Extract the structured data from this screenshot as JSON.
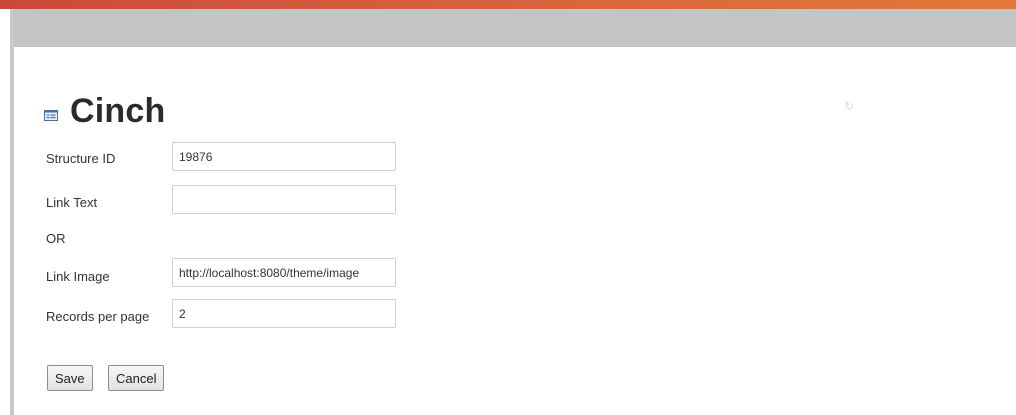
{
  "page": {
    "title": "Cinch",
    "title_icon": "form-icon",
    "accent_color": "#d7603e",
    "header_bar_color": "#c4c4c4"
  },
  "form": {
    "structure_id": {
      "label": "Structure ID",
      "value": "19876"
    },
    "link_text": {
      "label": "Link Text",
      "value": ""
    },
    "or_label": "OR",
    "link_image": {
      "label": "Link Image",
      "value": "http://localhost:8080/theme/image"
    },
    "records_per_page": {
      "label": "Records per page",
      "value": "2"
    }
  },
  "actions": {
    "save_label": "Save",
    "cancel_label": "Cancel"
  }
}
